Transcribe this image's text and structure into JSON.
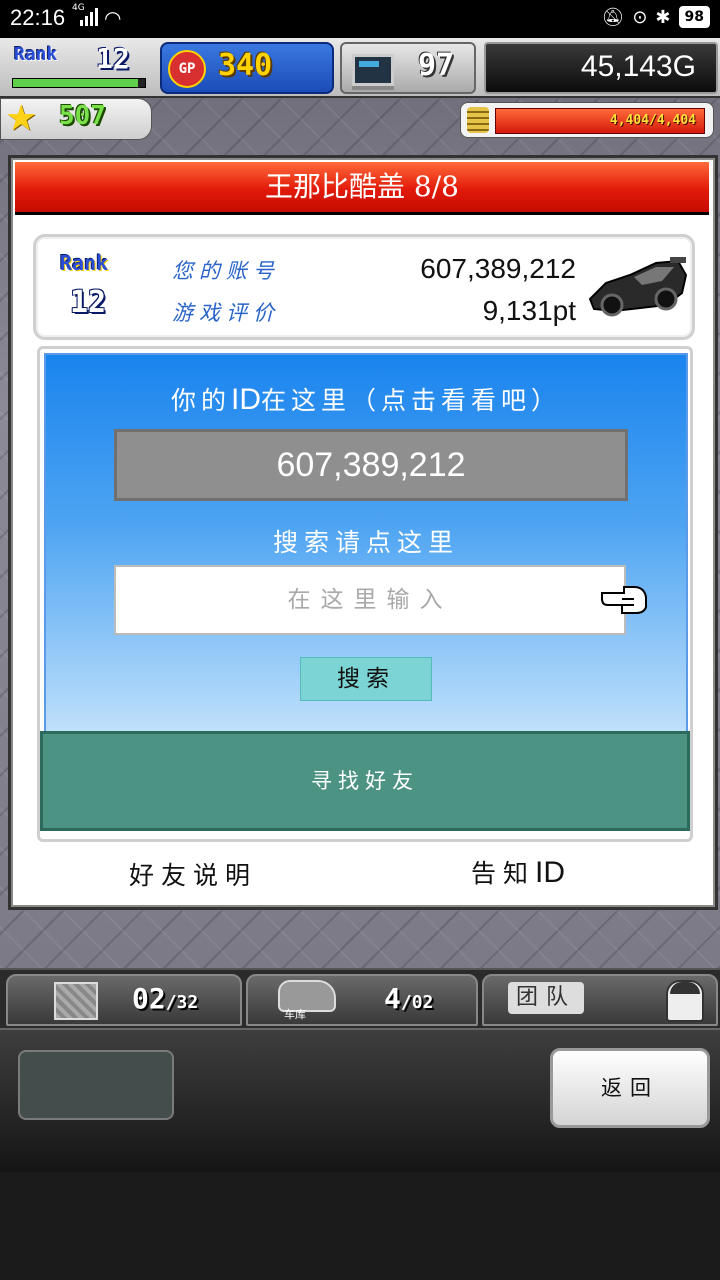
{
  "status_bar": {
    "time": "22:16",
    "network": "4G",
    "battery": "98"
  },
  "hud": {
    "rank_label": "Rank",
    "rank": "12",
    "rank_progress": 0.95,
    "gp_icon": "GP",
    "gp": "340",
    "research": "97",
    "gold": "45,143G",
    "stars": "507",
    "energy_text": "4,404/4,404",
    "energy_fill": 1.0
  },
  "dialog": {
    "title": "王那比酷盖 8/8",
    "profile": {
      "rank_label": "Rank",
      "rank": "12",
      "account_label": "您的账号",
      "account_value": "607,389,212",
      "rating_label": "游戏评价",
      "rating_value": "9,131pt"
    },
    "search": {
      "id_heading_prefix": "你的",
      "id_heading_id": "ID",
      "id_heading_suffix": "在这里（点击看看吧）",
      "id_value": "607,389,212",
      "search_heading": "搜索请点这里",
      "input_placeholder": "在这里输入",
      "search_button": "搜索",
      "find_friend_button": "寻找好友"
    },
    "friend_help": "好友说明",
    "notify_prefix": "告知",
    "notify_id": "ID"
  },
  "bottom_tabs": {
    "crates": "02",
    "crates_max": "/32",
    "garage_label": "车库",
    "garage": "4",
    "garage_max": "/02",
    "team_label": "团队"
  },
  "bottom_panel": {
    "back_button": "返回"
  },
  "icons": {
    "gp": "gp-icon",
    "research": "computer-icon",
    "star": "star-icon",
    "coin": "coin-stack-icon",
    "car": "race-car-icon",
    "hand": "pointing-hand-icon",
    "crate": "crate-icon",
    "garage": "garage-car-icon",
    "avatar": "avatar-icon"
  }
}
